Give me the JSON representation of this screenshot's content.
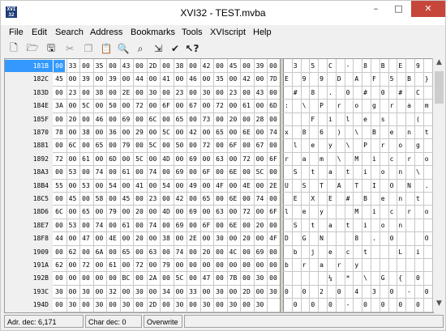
{
  "window": {
    "title": "XVI32 - TEST.mvba",
    "icon_text": "XVI 32"
  },
  "title_buttons": {
    "minimize": "–",
    "maximize": "□",
    "close": "✕"
  },
  "menu": [
    "File",
    "Edit",
    "Search",
    "Address",
    "Bookmarks",
    "Tools",
    "XVIscript",
    "Help"
  ],
  "toolbar": [
    "new-file-icon",
    "open-folder-icon",
    "save-icon",
    "cut-icon",
    "copy-icon",
    "paste-icon",
    "find-icon",
    "find-replace-icon",
    "goto-address-icon",
    "bookmark-icon",
    "context-help-icon"
  ],
  "rows": [
    {
      "addr": "181B",
      "hex": [
        "00",
        "33",
        "00",
        "35",
        "00",
        "43",
        "00",
        "2D",
        "00",
        "38",
        "00",
        "42",
        "00",
        "45",
        "00",
        "39",
        "00"
      ],
      "chars": [
        "",
        "3",
        "",
        "5",
        "",
        "C",
        "",
        "-",
        "",
        "8",
        "",
        "B",
        "",
        "E",
        "",
        "9",
        ""
      ]
    },
    {
      "addr": "182C",
      "hex": [
        "45",
        "00",
        "39",
        "00",
        "39",
        "00",
        "44",
        "00",
        "41",
        "00",
        "46",
        "00",
        "35",
        "00",
        "42",
        "00",
        "7D"
      ],
      "chars": [
        "E",
        "",
        "9",
        "",
        "9",
        "",
        "D",
        "",
        "A",
        "",
        "F",
        "",
        "5",
        "",
        "B",
        "",
        "}"
      ]
    },
    {
      "addr": "183D",
      "hex": [
        "00",
        "23",
        "00",
        "38",
        "00",
        "2E",
        "00",
        "30",
        "00",
        "23",
        "00",
        "30",
        "00",
        "23",
        "00",
        "43",
        "00"
      ],
      "chars": [
        "",
        "#",
        "",
        "8",
        "",
        ".",
        "",
        "0",
        "",
        "#",
        "",
        "0",
        "",
        "#",
        "",
        "C",
        ""
      ]
    },
    {
      "addr": "184E",
      "hex": [
        "3A",
        "00",
        "5C",
        "00",
        "50",
        "00",
        "72",
        "00",
        "6F",
        "00",
        "67",
        "00",
        "72",
        "00",
        "61",
        "00",
        "6D"
      ],
      "chars": [
        ":",
        "",
        "\\",
        "",
        "P",
        "",
        "r",
        "",
        "o",
        "",
        "g",
        "",
        "r",
        "",
        "a",
        "",
        "m"
      ]
    },
    {
      "addr": "185F",
      "hex": [
        "00",
        "20",
        "00",
        "46",
        "00",
        "69",
        "00",
        "6C",
        "00",
        "65",
        "00",
        "73",
        "00",
        "20",
        "00",
        "28",
        "00"
      ],
      "chars": [
        "",
        "",
        "",
        "F",
        "",
        "i",
        "",
        "l",
        "",
        "e",
        "",
        "s",
        "",
        "",
        "",
        "(",
        ""
      ]
    },
    {
      "addr": "1870",
      "hex": [
        "78",
        "00",
        "38",
        "00",
        "36",
        "00",
        "29",
        "00",
        "5C",
        "00",
        "42",
        "00",
        "65",
        "00",
        "6E",
        "00",
        "74"
      ],
      "chars": [
        "x",
        "",
        "8",
        "",
        "6",
        "",
        ")",
        "",
        "\\",
        "",
        "B",
        "",
        "e",
        "",
        "n",
        "",
        "t"
      ]
    },
    {
      "addr": "1881",
      "hex": [
        "00",
        "6C",
        "00",
        "65",
        "00",
        "79",
        "00",
        "5C",
        "00",
        "50",
        "00",
        "72",
        "00",
        "6F",
        "00",
        "67",
        "00"
      ],
      "chars": [
        "",
        "l",
        "",
        "e",
        "",
        "y",
        "",
        "\\",
        "",
        "P",
        "",
        "r",
        "",
        "o",
        "",
        "g",
        ""
      ]
    },
    {
      "addr": "1892",
      "hex": [
        "72",
        "00",
        "61",
        "00",
        "6D",
        "00",
        "5C",
        "00",
        "4D",
        "00",
        "69",
        "00",
        "63",
        "00",
        "72",
        "00",
        "6F"
      ],
      "chars": [
        "r",
        "",
        "a",
        "",
        "m",
        "",
        "\\",
        "",
        "M",
        "",
        "i",
        "",
        "c",
        "",
        "r",
        "",
        "o"
      ]
    },
    {
      "addr": "18A3",
      "hex": [
        "00",
        "53",
        "00",
        "74",
        "00",
        "61",
        "00",
        "74",
        "00",
        "69",
        "00",
        "6F",
        "00",
        "6E",
        "00",
        "5C",
        "00"
      ],
      "chars": [
        "",
        "S",
        "",
        "t",
        "",
        "a",
        "",
        "t",
        "",
        "i",
        "",
        "o",
        "",
        "n",
        "",
        "\\",
        ""
      ]
    },
    {
      "addr": "18B4",
      "hex": [
        "55",
        "00",
        "53",
        "00",
        "54",
        "00",
        "41",
        "00",
        "54",
        "00",
        "49",
        "00",
        "4F",
        "00",
        "4E",
        "00",
        "2E"
      ],
      "chars": [
        "U",
        "",
        "S",
        "",
        "T",
        "",
        "A",
        "",
        "T",
        "",
        "I",
        "",
        "O",
        "",
        "N",
        "",
        "."
      ]
    },
    {
      "addr": "18C5",
      "hex": [
        "00",
        "45",
        "00",
        "58",
        "00",
        "45",
        "00",
        "23",
        "00",
        "42",
        "00",
        "65",
        "00",
        "6E",
        "00",
        "74",
        "00"
      ],
      "chars": [
        "",
        "E",
        "",
        "X",
        "",
        "E",
        "",
        "#",
        "",
        "B",
        "",
        "e",
        "",
        "n",
        "",
        "t",
        ""
      ]
    },
    {
      "addr": "18D6",
      "hex": [
        "6C",
        "00",
        "65",
        "00",
        "79",
        "00",
        "20",
        "00",
        "4D",
        "00",
        "69",
        "00",
        "63",
        "00",
        "72",
        "00",
        "6F"
      ],
      "chars": [
        "l",
        "",
        "e",
        "",
        "y",
        "",
        "",
        "",
        "M",
        "",
        "i",
        "",
        "c",
        "",
        "r",
        "",
        "o"
      ]
    },
    {
      "addr": "18E7",
      "hex": [
        "00",
        "53",
        "00",
        "74",
        "00",
        "61",
        "00",
        "74",
        "00",
        "69",
        "00",
        "6F",
        "00",
        "6E",
        "00",
        "20",
        "00"
      ],
      "chars": [
        "",
        "S",
        "",
        "t",
        "",
        "a",
        "",
        "t",
        "",
        "i",
        "",
        "o",
        "",
        "n",
        "",
        "",
        ""
      ]
    },
    {
      "addr": "18F8",
      "hex": [
        "44",
        "00",
        "47",
        "00",
        "4E",
        "00",
        "20",
        "00",
        "38",
        "00",
        "2E",
        "00",
        "30",
        "00",
        "20",
        "00",
        "4F"
      ],
      "chars": [
        "D",
        "",
        "G",
        "",
        "N",
        "",
        "",
        "",
        "8",
        "",
        ".",
        "",
        "0",
        "",
        "",
        "",
        "O"
      ]
    },
    {
      "addr": "1909",
      "hex": [
        "00",
        "62",
        "00",
        "6A",
        "00",
        "65",
        "00",
        "63",
        "00",
        "74",
        "00",
        "20",
        "00",
        "4C",
        "00",
        "69",
        "00"
      ],
      "chars": [
        "",
        "b",
        "",
        "j",
        "",
        "e",
        "",
        "c",
        "",
        "t",
        "",
        "",
        "",
        "L",
        "",
        "i",
        ""
      ]
    },
    {
      "addr": "191A",
      "hex": [
        "62",
        "00",
        "72",
        "00",
        "61",
        "00",
        "72",
        "00",
        "79",
        "00",
        "00",
        "00",
        "00",
        "00",
        "00",
        "00",
        "00"
      ],
      "chars": [
        "b",
        "",
        "r",
        "",
        "a",
        "",
        "r",
        "",
        "y",
        "",
        "",
        "",
        "",
        "",
        "",
        "",
        ""
      ]
    },
    {
      "addr": "192B",
      "hex": [
        "00",
        "00",
        "00",
        "00",
        "00",
        "BC",
        "00",
        "2A",
        "00",
        "5C",
        "00",
        "47",
        "00",
        "7B",
        "00",
        "30",
        "00"
      ],
      "chars": [
        "",
        "",
        "",
        "",
        "",
        "¼",
        "",
        "*",
        "",
        "\\",
        "",
        "G",
        "",
        "{",
        "",
        "0",
        ""
      ]
    },
    {
      "addr": "193C",
      "hex": [
        "30",
        "00",
        "30",
        "00",
        "32",
        "00",
        "30",
        "00",
        "34",
        "00",
        "33",
        "00",
        "30",
        "00",
        "2D",
        "00",
        "30"
      ],
      "chars": [
        "0",
        "",
        "0",
        "",
        "2",
        "",
        "0",
        "",
        "4",
        "",
        "3",
        "",
        "0",
        "",
        "-",
        "",
        "0"
      ]
    },
    {
      "addr": "194D",
      "hex": [
        "00",
        "30",
        "00",
        "30",
        "00",
        "30",
        "00",
        "2D",
        "00",
        "30",
        "00",
        "30",
        "00",
        "30",
        "00",
        "30",
        ""
      ],
      "chars": [
        "",
        "0",
        "",
        "0",
        "",
        "0",
        "",
        "-",
        "",
        "0",
        "",
        "0",
        "",
        "0",
        "",
        "0",
        ""
      ]
    }
  ],
  "selected": {
    "row": 0,
    "col": 0
  },
  "scrollbar": {
    "up": "▲",
    "down": "▼"
  },
  "status": {
    "address": "Adr. dec: 6,171",
    "char": "Char dec: 0",
    "mode": "Overwrite"
  }
}
